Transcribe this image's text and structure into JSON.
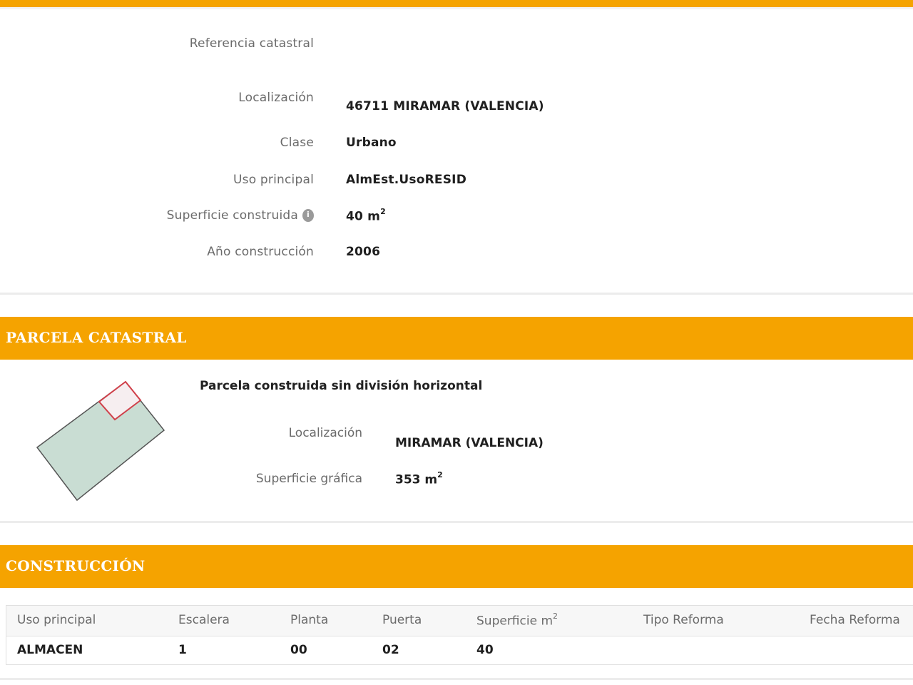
{
  "inmueble": {
    "ref_label": "Referencia catastral",
    "ref_value": "",
    "loc_label": "Localización",
    "loc_value": "46711 MIRAMAR (VALENCIA)",
    "clase_label": "Clase",
    "clase_value": "Urbano",
    "uso_label": "Uso principal",
    "uso_value": "AlmEst.UsoRESID",
    "sup_label": "Superficie construida",
    "sup_value": "40 m",
    "sup_unit_exp": "2",
    "anio_label": "Año construcción",
    "anio_value": "2006"
  },
  "parcela": {
    "section_title": "PARCELA CATASTRAL",
    "heading": "Parcela construida sin división horizontal",
    "loc_label": "Localización",
    "loc_value": "MIRAMAR (VALENCIA)",
    "sup_label": "Superficie gráfica",
    "sup_value": "353 m",
    "sup_unit_exp": "2"
  },
  "construccion": {
    "section_title": "CONSTRUCCIÓN",
    "columns": [
      "Uso principal",
      "Escalera",
      "Planta",
      "Puerta",
      "Superficie m",
      "Tipo Reforma",
      "Fecha Reforma"
    ],
    "superficie_exp": "2",
    "rows": [
      [
        "ALMACEN",
        "1",
        "00",
        "02",
        "40",
        "",
        ""
      ]
    ]
  },
  "icons": {
    "superficie_info": "info-icon",
    "parcel_plan": "parcel-plan-icon"
  },
  "colors": {
    "accent": "#f5a300",
    "parcel_fill": "#c9ddd3",
    "building_outline": "#d0404a"
  }
}
